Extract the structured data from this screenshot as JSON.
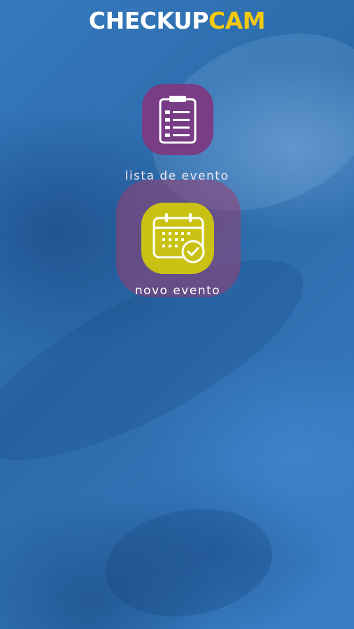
{
  "app": {
    "brand_part1": "CHECKUP",
    "brand_part2": "CAM"
  },
  "menu": {
    "items": [
      {
        "label": "lista de evento",
        "icon": "clipboard-list-icon",
        "color": "#783d84"
      },
      {
        "label": "novo evento",
        "icon": "calendar-check-icon",
        "color": "#c9c214",
        "highlighted": true
      }
    ]
  },
  "colors": {
    "background": "#2f72b4",
    "brand_accent": "#f2c811",
    "highlight": "#a03c6e"
  }
}
